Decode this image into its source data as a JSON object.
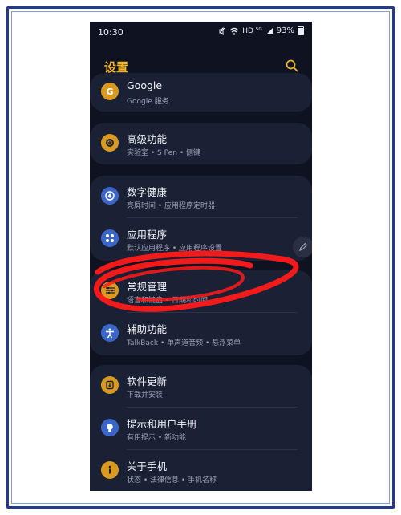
{
  "status_bar": {
    "time": "10:30",
    "icons_text": "HD ⁵ᴳ",
    "battery": "93%"
  },
  "header": {
    "title": "设置",
    "search_icon": "search-icon",
    "accent_color": "#f2b524"
  },
  "settings": {
    "google": {
      "title": "Google",
      "subtitle": "Google 服务",
      "icon": "G",
      "color": "#d99a1f"
    },
    "advanced": {
      "title": "高级功能",
      "subtitle": "实验室 • S Pen • 侧键",
      "icon": "gear-plus-icon",
      "color": "#d99a1f"
    },
    "digital_wellbeing": {
      "title": "数字健康",
      "subtitle": "亮屏时间 • 应用程序定时器",
      "icon": "wellbeing-icon",
      "color": "#3b66c9"
    },
    "apps": {
      "title": "应用程序",
      "subtitle": "默认应用程序 • 应用程序设置",
      "icon": "apps-icon",
      "color": "#3b66c9"
    },
    "general_management": {
      "title": "常规管理",
      "subtitle": "语言和键盘 • 日期和时间",
      "icon": "sliders-icon",
      "color": "#d99a1f"
    },
    "accessibility": {
      "title": "辅助功能",
      "subtitle": "TalkBack • 单声道音频 • 悬浮菜单",
      "icon": "accessibility-icon",
      "color": "#3b66c9"
    },
    "software_update": {
      "title": "软件更新",
      "subtitle": "下载并安装",
      "icon": "update-icon",
      "color": "#d99a1f"
    },
    "tips": {
      "title": "提示和用户手册",
      "subtitle": "有用提示 • 新功能",
      "icon": "lightbulb-icon",
      "color": "#3b66c9"
    },
    "about_phone": {
      "title": "关于手机",
      "subtitle": "状态 • 法律信息 • 手机名称",
      "icon": "info-icon",
      "color": "#d99a1f"
    }
  },
  "annotation": {
    "color": "#ff1a1a"
  }
}
